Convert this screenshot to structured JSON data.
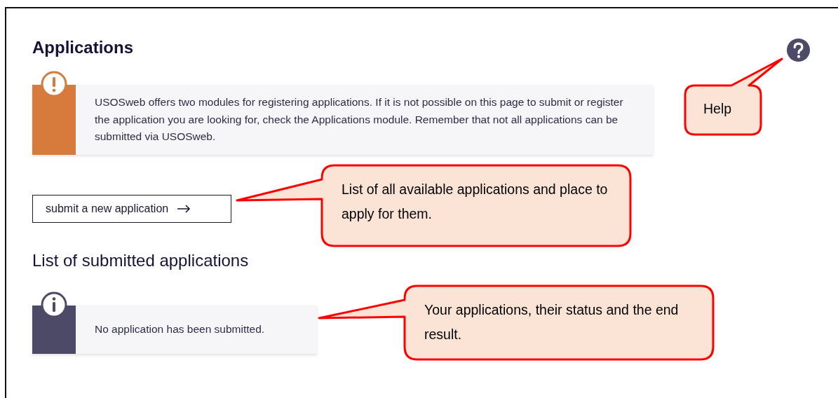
{
  "page": {
    "title": "Applications"
  },
  "alert": {
    "kind": "warning",
    "text": "USOSweb offers two modules for registering applications. If it is not possible on this page to submit or register the application you are looking for, check the Applications module. Remember that not all applications can be submitted via USOSweb."
  },
  "submit_button": {
    "label": "submit a new application"
  },
  "submitted_section": {
    "title": "List of submitted applications"
  },
  "info": {
    "kind": "info",
    "text": "No application has been submitted."
  },
  "callouts": [
    {
      "text": "Help"
    },
    {
      "text": "List of all available applications and place to apply for them."
    },
    {
      "text": "Your applications, their status and the end result."
    }
  ]
}
